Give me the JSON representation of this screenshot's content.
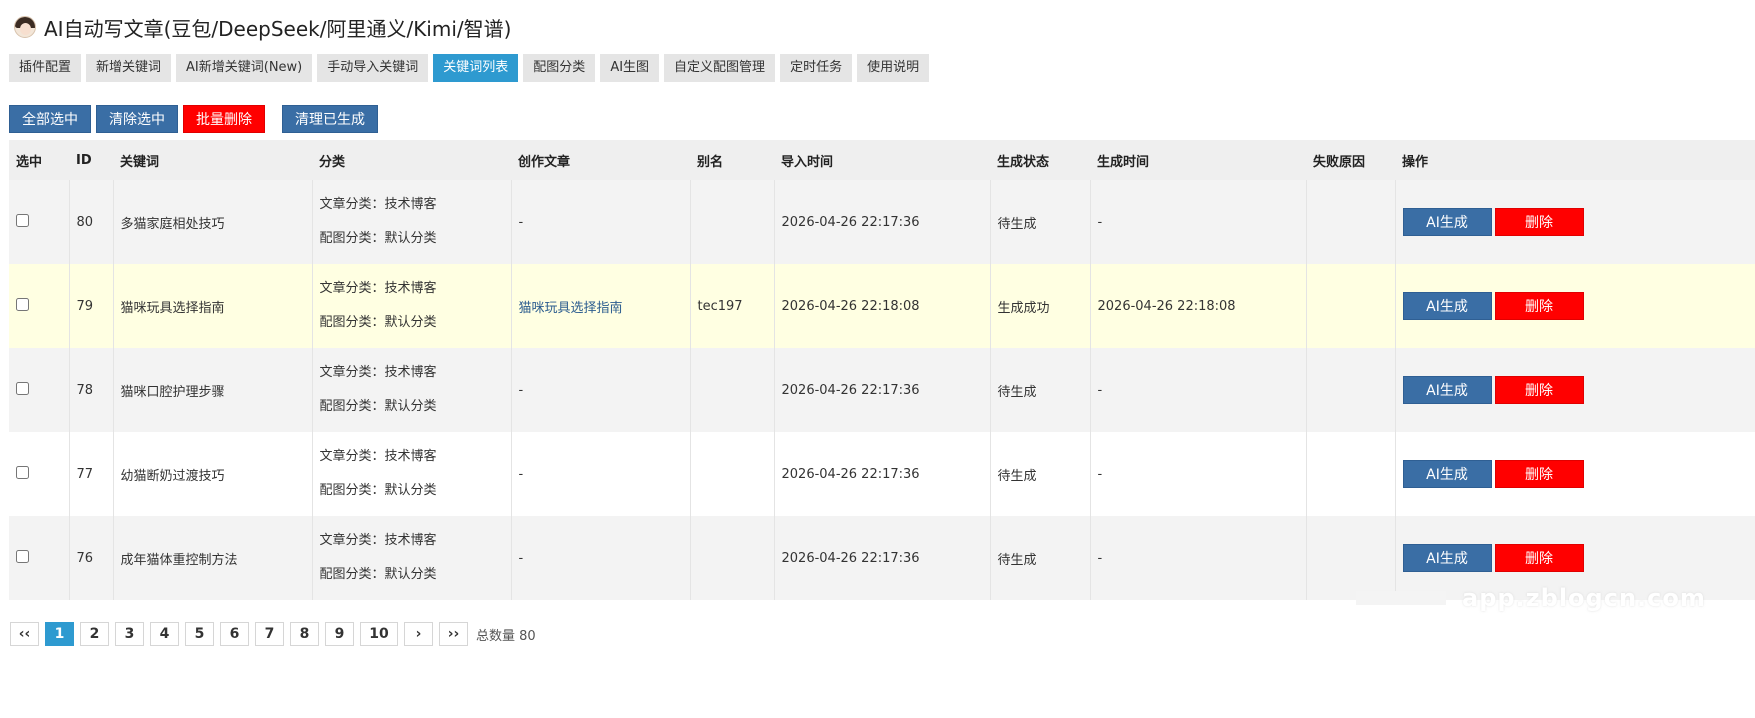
{
  "header": {
    "title": "AI自动写文章(豆包/DeepSeek/阿里通义/Kimi/智谱)"
  },
  "tabs": [
    {
      "label": "插件配置",
      "active": false
    },
    {
      "label": "新增关键词",
      "active": false
    },
    {
      "label": "AI新增关键词(New)",
      "active": false
    },
    {
      "label": "手动导入关键词",
      "active": false
    },
    {
      "label": "关键词列表",
      "active": true
    },
    {
      "label": "配图分类",
      "active": false
    },
    {
      "label": "AI生图",
      "active": false
    },
    {
      "label": "自定义配图管理",
      "active": false
    },
    {
      "label": "定时任务",
      "active": false
    },
    {
      "label": "使用说明",
      "active": false
    }
  ],
  "actions": {
    "select_all": "全部选中",
    "clear_selection": "清除选中",
    "bulk_delete": "批量删除",
    "clear_generated": "清理已生成"
  },
  "table": {
    "headers": {
      "select": "选中",
      "id": "ID",
      "keyword": "关键词",
      "category": "分类",
      "article": "创作文章",
      "alias": "别名",
      "import_time": "导入时间",
      "status": "生成状态",
      "gen_time": "生成时间",
      "fail_reason": "失败原因",
      "ops": "操作"
    },
    "ai_button": "AI生成",
    "delete_button": "删除",
    "rows": [
      {
        "id": "80",
        "keyword": "多猫家庭相处技巧",
        "article_cat": "文章分类：技术博客",
        "image_cat": "配图分类：默认分类",
        "article": "-",
        "alias": "",
        "import_time": "2026-04-26 22:17:36",
        "status": "待生成",
        "gen_time": "-",
        "fail_reason": ""
      },
      {
        "id": "79",
        "keyword": "猫咪玩具选择指南",
        "article_cat": "文章分类：技术博客",
        "image_cat": "配图分类：默认分类",
        "article": "猫咪玩具选择指南",
        "alias": "tec197",
        "import_time": "2026-04-26 22:18:08",
        "status": "生成成功",
        "gen_time": "2026-04-26 22:18:08",
        "fail_reason": ""
      },
      {
        "id": "78",
        "keyword": "猫咪口腔护理步骤",
        "article_cat": "文章分类：技术博客",
        "image_cat": "配图分类：默认分类",
        "article": "-",
        "alias": "",
        "import_time": "2026-04-26 22:17:36",
        "status": "待生成",
        "gen_time": "-",
        "fail_reason": ""
      },
      {
        "id": "77",
        "keyword": "幼猫断奶过渡技巧",
        "article_cat": "文章分类：技术博客",
        "image_cat": "配图分类：默认分类",
        "article": "-",
        "alias": "",
        "import_time": "2026-04-26 22:17:36",
        "status": "待生成",
        "gen_time": "-",
        "fail_reason": ""
      },
      {
        "id": "76",
        "keyword": "成年猫体重控制方法",
        "article_cat": "文章分类：技术博客",
        "image_cat": "配图分类：默认分类",
        "article": "-",
        "alias": "",
        "import_time": "2026-04-26 22:17:36",
        "status": "待生成",
        "gen_time": "-",
        "fail_reason": ""
      }
    ]
  },
  "pagination": {
    "first": "‹‹",
    "pages": [
      "1",
      "2",
      "3",
      "4",
      "5",
      "6",
      "7",
      "8",
      "9",
      "10"
    ],
    "current": "1",
    "next": "›",
    "last": "››",
    "total_text": "总数量 80"
  },
  "watermark": "app.zblogcn.com",
  "colors": {
    "accent": "#2e9ad0",
    "primary_button": "#3a6ea5",
    "danger": "#ff0000",
    "success": "#14a34a",
    "highlight_row": "#ffffe2"
  }
}
